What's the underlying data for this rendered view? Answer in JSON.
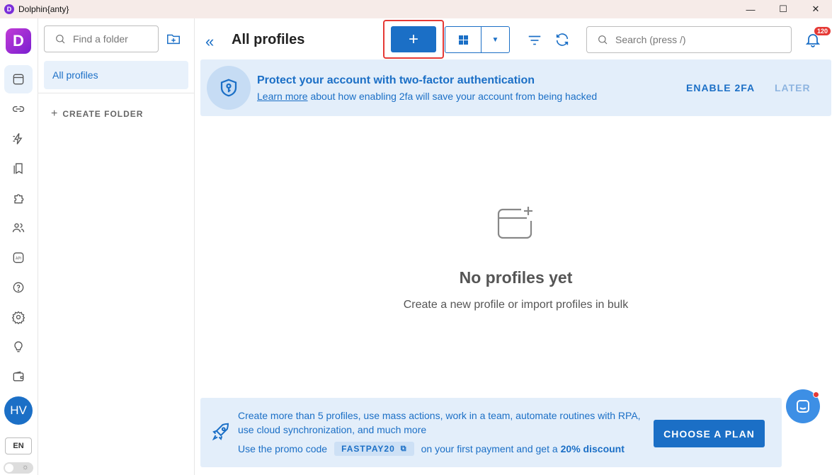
{
  "window": {
    "title": "Dolphin{anty}",
    "minimize": "—",
    "maximize": "☐",
    "close": "✕"
  },
  "rail": {
    "logo": "D",
    "avatar_initials": "HV",
    "language": "EN",
    "icons": [
      "browser-profiles-icon",
      "link-icon",
      "automation-icon",
      "bookmarks-icon",
      "extensions-icon",
      "users-icon",
      "api-icon",
      "help-icon",
      "settings-icon",
      "tips-icon",
      "wallet-icon"
    ]
  },
  "folders": {
    "search_placeholder": "Find a folder",
    "items": [
      {
        "label": "All profiles"
      }
    ],
    "create_label": "CREATE FOLDER"
  },
  "header": {
    "title": "All profiles",
    "new_button": "+",
    "search_placeholder": "Search (press /)",
    "notifications_count": "120"
  },
  "banner_2fa": {
    "headline": "Protect your account with two-factor authentication",
    "link": "Learn more",
    "text": " about how enabling 2fa will save your account from being hacked",
    "enable": "ENABLE 2FA",
    "later": "LATER"
  },
  "empty_state": {
    "title": "No profiles yet",
    "subtitle": "Create a new profile or import profiles in bulk"
  },
  "promo": {
    "line1": "Create more than 5 profiles, use mass actions, work in a team, automate routines with RPA,",
    "line2": "use cloud synchronization, and much more",
    "code_prefix": "Use the promo code",
    "code": "FASTPAY20",
    "code_suffix": "on your first payment and get a",
    "discount": "20% discount",
    "button": "CHOOSE A PLAN"
  },
  "colors": {
    "accent": "#1b6fc6",
    "banner_bg": "#e3eefa",
    "highlight_border": "#e53935",
    "badge": "#e53935"
  }
}
